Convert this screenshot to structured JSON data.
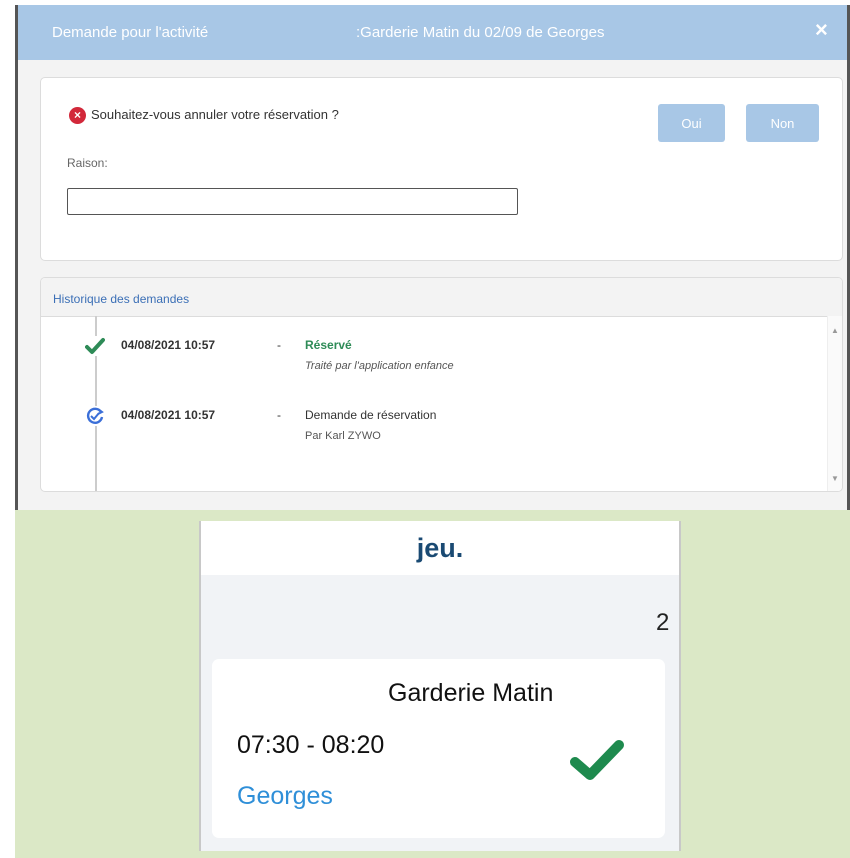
{
  "dialog": {
    "title_left": "Demande pour l'activité",
    "title_right": ":Garderie Matin du 02/09 de Georges",
    "close_label": "×",
    "cancel_prompt": {
      "question": "Souhaitez-vous annuler votre réservation ?",
      "error_icon_glyph": "×",
      "reason_label": "Raison:",
      "reason_value": "",
      "yes_label": "Oui",
      "no_label": "Non"
    },
    "history": {
      "title": "Historique des demandes",
      "entries": [
        {
          "icon": "check-icon",
          "timestamp": "04/08/2021 10:57",
          "separator": "-",
          "status": "Réservé",
          "detail": "Traité par l'application enfance"
        },
        {
          "icon": "refresh-check-icon",
          "timestamp": "04/08/2021 10:57",
          "separator": "-",
          "status": "Demande de réservation",
          "detail": "Par Karl ZYWO"
        }
      ]
    }
  },
  "calendar": {
    "day_label": "jeu.",
    "day_number": "2",
    "activity": {
      "name": "Garderie Matin",
      "time": "07:30 - 08:20",
      "child": "Georges",
      "status_icon": "check-icon"
    }
  },
  "colors": {
    "title_bar": "#a8c7e6",
    "success_green": "#2e8b57",
    "error_red": "#d2283a",
    "link_blue": "#2f8fd8",
    "background_green": "#dbe8c6"
  }
}
